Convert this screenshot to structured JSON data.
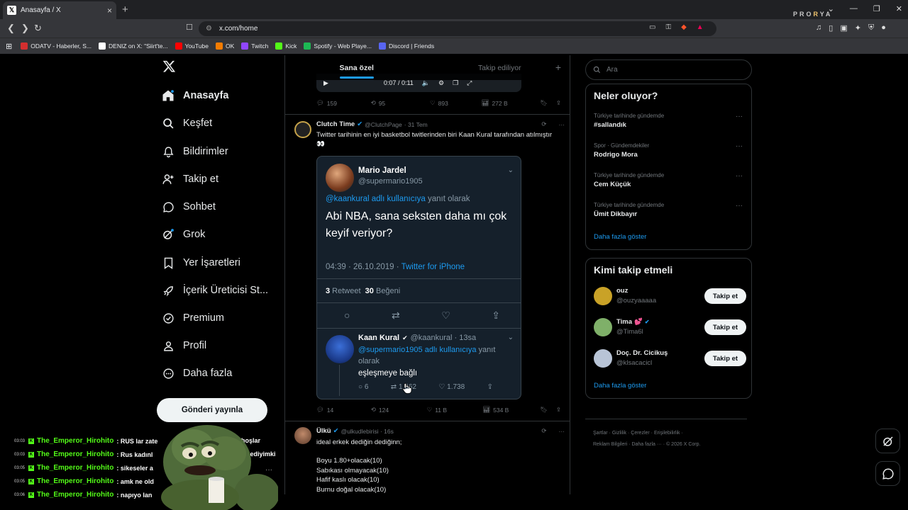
{
  "browser": {
    "tab_title": "Anasayfa / X",
    "tab_close": "×",
    "new_tab": "+",
    "address": "x.com/home",
    "brand_prefix": "PRO",
    "brand_accent": "R",
    "brand_suffix": "YA",
    "bookmarks": [
      {
        "label": "ODATV - Haberler, S...",
        "color": "#d32f2f"
      },
      {
        "label": "DENIZ on X: \"Siirt'te...",
        "color": "#ffffff"
      },
      {
        "label": "YouTube",
        "color": "#ff0000"
      },
      {
        "label": "OK",
        "color": "#f57c00"
      },
      {
        "label": "Twitch",
        "color": "#9146ff"
      },
      {
        "label": "Kick",
        "color": "#53fc18"
      },
      {
        "label": "Spotify - Web Playe...",
        "color": "#1db954"
      },
      {
        "label": "Discord | Friends",
        "color": "#5865f2"
      }
    ]
  },
  "nav": {
    "items": [
      "Anasayfa",
      "Keşfet",
      "Bildirimler",
      "Takip et",
      "Sohbet",
      "Grok",
      "Yer İşaretleri",
      "İçerik Üreticisi St...",
      "Premium",
      "Profil",
      "Daha fazla"
    ],
    "post_button": "Gönderi yayınla"
  },
  "feed": {
    "tabs": [
      "Sana özel",
      "Takip ediliyor"
    ],
    "video_time": "0:07 / 0:11",
    "prev_stats": {
      "replies": "159",
      "reposts": "95",
      "likes": "893",
      "views": "272 B"
    },
    "post1": {
      "name": "Clutch Time",
      "handle": "@ClutchPage",
      "time": "· 31 Tem",
      "text": "Twitter tarihinin en iyi basketbol twitlerinden biri Kaan Kural tarafından atılmıştır 👀",
      "quote": {
        "name": "Mario Jardel",
        "handle": "@supermario1905",
        "reply_to_link": "@kaankural adlı kullanıcıya",
        "reply_to_rest": " yanıt olarak",
        "text": "Abi NBA, sana seksten daha mı çok keyif veriyor?",
        "datetime": "04:39 · 26.10.2019 · ",
        "client": "Twitter for iPhone",
        "retweets": "3",
        "retweets_label": " Retweet",
        "likes": "30",
        "likes_label": " Beğeni",
        "reply": {
          "name": "Kaan Kural",
          "handle": "@kaankural · 13sa",
          "reply_link": "@supermario1905 adlı kullanıcıya",
          "reply_rest": " yanıt olarak",
          "text": "eşleşmeye bağlı",
          "replies": "6",
          "retweets": "1.362",
          "likes": "1.738"
        }
      },
      "stats": {
        "replies": "14",
        "reposts": "124",
        "likes": "11 B",
        "views": "534 B"
      }
    },
    "post2": {
      "name": "Ülkü",
      "handle": "@ulkudlebirisi · 16s",
      "lines": [
        "ideal erkek dediğin dediğinn;",
        "",
        "Boyu 1.80+olacak(10)",
        "Sabıkası olmayacak(10)",
        "Hafif kaslı olacak(10)",
        "Burnu doğal olacak(10)"
      ]
    }
  },
  "sidebar": {
    "search_placeholder": "Ara",
    "trends_title": "Neler oluyor?",
    "trends": [
      {
        "category": "Türkiye tarihinde gündemde",
        "name": "#sallandık"
      },
      {
        "category": "Spor · Gündemdekiler",
        "name": "Rodrigo Mora"
      },
      {
        "category": "Türkiye tarihinde gündemde",
        "name": "Cem Küçük"
      },
      {
        "category": "Türkiye tarihinde gündemde",
        "name": "Ümit Dikbayır"
      }
    ],
    "trends_more": "Daha fazla göster",
    "who_title": "Kimi takip etmeli",
    "who": [
      {
        "name": "ouz",
        "handle": "@ouzyaaaaa",
        "verified": false,
        "heart": "",
        "avatar_color": "#c9a227"
      },
      {
        "name": "Tima",
        "handle": "@Tima6l",
        "verified": true,
        "heart": "💕",
        "avatar_color": "#7fb069"
      },
      {
        "name": "Doç. Dr. Cicikuş",
        "handle": "@klsacacicl",
        "verified": false,
        "heart": "",
        "avatar_color": "#b8c4d6"
      }
    ],
    "follow_label": "Takip et",
    "who_more": "Daha fazla göster",
    "footer_line1": "Şartlar  ·  Gizlilik  ·  Çerezler  ·  Erişilebilirlik  ·",
    "footer_line2": "Reklam Bilgileri  ·  Daha fazla ···  ·  © 2026 X Corp."
  },
  "chat": [
    {
      "time": "03:03",
      "user": "The_Emperor_Hirohito",
      "msg": ": RUS lar zate"
    },
    {
      "time": "03:03",
      "user": "The_Emperor_Hirohito",
      "msg": ": Rus kadınl"
    },
    {
      "time": "03:05",
      "user": "The_Emperor_Hirohito",
      "msg": ": sikeseler a"
    },
    {
      "time": "03:05",
      "user": "The_Emperor_Hirohito",
      "msg": ": amk ne old"
    },
    {
      "time": "03:06",
      "user": "The_Emperor_Hirohito",
      "msg": ": napıyo lan"
    }
  ],
  "chat_tail": {
    "line1": "choşlar",
    "line2": ":D nediyimki"
  }
}
